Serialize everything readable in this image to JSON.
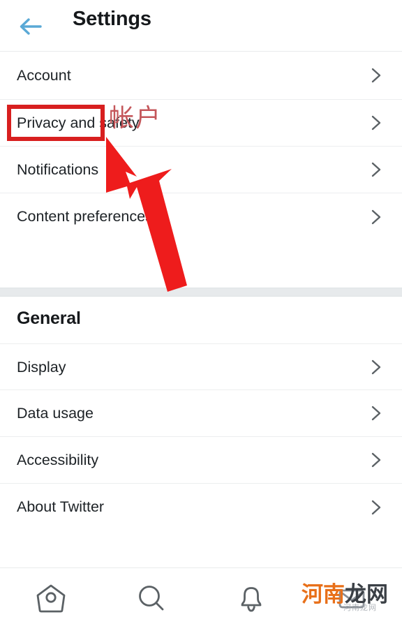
{
  "header": {
    "title": "Settings",
    "back_icon": "arrow-left-icon",
    "back_color": "#5aa9d6"
  },
  "sections": [
    {
      "id": "account",
      "title": "",
      "items": [
        {
          "label": "Account",
          "chevron": "chevron-right-icon"
        },
        {
          "label": "Privacy and safety",
          "chevron": "chevron-right-icon"
        },
        {
          "label": "Notifications",
          "chevron": "chevron-right-icon"
        },
        {
          "label": "Content preferences",
          "chevron": "chevron-right-icon"
        }
      ]
    },
    {
      "id": "general",
      "title": "General",
      "items": [
        {
          "label": "Display",
          "chevron": "chevron-right-icon"
        },
        {
          "label": "Data usage",
          "chevron": "chevron-right-icon"
        },
        {
          "label": "Accessibility",
          "chevron": "chevron-right-icon"
        },
        {
          "label": "About Twitter",
          "chevron": "chevron-right-icon"
        }
      ]
    }
  ],
  "bottom_nav": [
    {
      "name": "home-icon",
      "label": "Home"
    },
    {
      "name": "search-icon",
      "label": "Search"
    },
    {
      "name": "bell-icon",
      "label": "Notifications"
    },
    {
      "name": "envelope-icon",
      "label": "Messages"
    }
  ],
  "annotations": {
    "highlight_box": {
      "target": "Account",
      "color": "#d81f1f"
    },
    "chinese_label": "帐户",
    "chinese_color": "#c4565a",
    "arrow": {
      "color": "#ee1c1c",
      "points_to": "Account"
    }
  },
  "watermark": {
    "text_orange": "河南",
    "text_dark": "龙网",
    "color_orange": "#e8701a",
    "color_dark": "#3a3f45",
    "sub": "河南龙网"
  }
}
